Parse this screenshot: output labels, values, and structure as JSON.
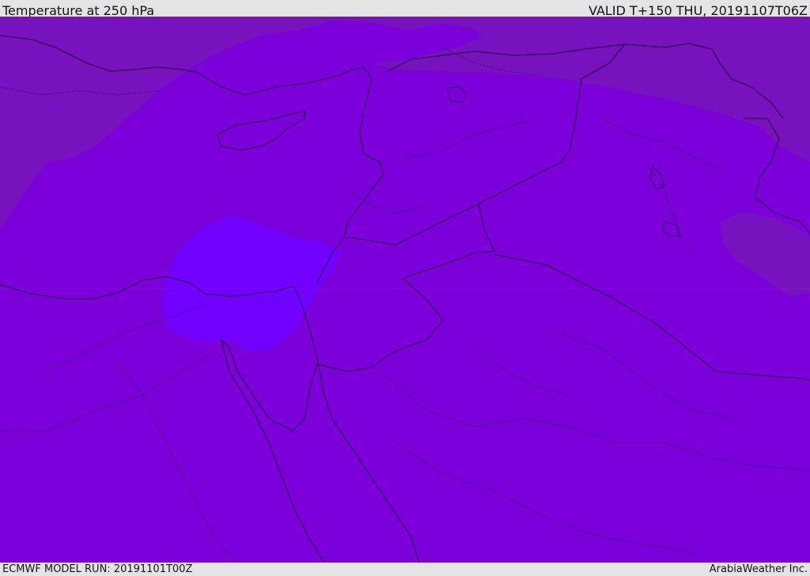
{
  "header": {
    "title": "Temperature at 250 hPa",
    "valid": "VALID T+150 THU, 20191107T06Z"
  },
  "footer": {
    "model_run": "ECMWF MODEL RUN: 20191101T00Z",
    "credit": "ArabiaWeather Inc."
  },
  "colors": {
    "base_field": "#7b00d9",
    "cold_band": "#7712bf",
    "warm_pocket": "#7000ff",
    "coastline": "#1a0033",
    "header_bg": "#e4e4e4"
  }
}
